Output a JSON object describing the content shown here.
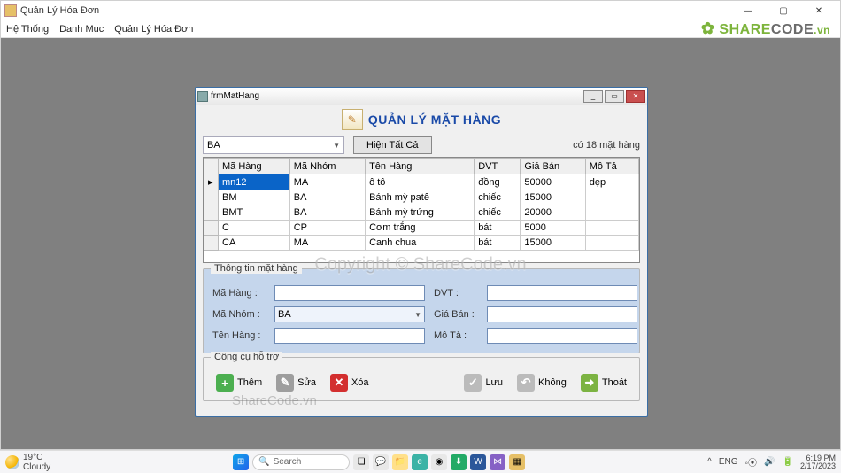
{
  "app": {
    "title": "Quản Lý Hóa Đơn",
    "menus": [
      "Hệ Thống",
      "Danh Mục",
      "Quản Lý Hóa Đơn"
    ]
  },
  "dialog": {
    "win_title": "frmMatHang",
    "title": "QUẢN LÝ MẶT HÀNG",
    "filter_value": "BA",
    "show_all": "Hiện Tất Cả",
    "count_text": "có 18 mặt hàng",
    "columns": [
      "Mã Hàng",
      "Mã Nhóm",
      "Tên Hàng",
      "DVT",
      "Giá Bán",
      "Mô Tả"
    ],
    "rows": [
      {
        "ma": "mn12",
        "nhom": "MA",
        "ten": "ô tô",
        "dvt": "đồng",
        "gia": "50000",
        "mota": "dẹp",
        "sel": true
      },
      {
        "ma": "BM",
        "nhom": "BA",
        "ten": "Bánh mỳ patê",
        "dvt": "chiếc",
        "gia": "15000",
        "mota": ""
      },
      {
        "ma": "BMT",
        "nhom": "BA",
        "ten": "Bánh mỳ trứng",
        "dvt": "chiếc",
        "gia": "20000",
        "mota": ""
      },
      {
        "ma": "C",
        "nhom": "CP",
        "ten": "Cơm trắng",
        "dvt": "bát",
        "gia": "5000",
        "mota": ""
      },
      {
        "ma": "CA",
        "nhom": "MA",
        "ten": "Canh chua",
        "dvt": "bát",
        "gia": "15000",
        "mota": ""
      }
    ],
    "info_group": "Thông tin mặt hàng",
    "labels": {
      "ma": "Mã Hàng :",
      "nhom": "Mã Nhóm :",
      "ten": "Tên Hàng :",
      "dvt": "DVT :",
      "gia": "Giá Bán :",
      "mota": "Mô Tả :"
    },
    "form": {
      "ma": "",
      "nhom": "BA",
      "ten": "",
      "dvt": "",
      "gia": "",
      "mota": ""
    },
    "tool_group": "Công cụ hỗ trợ",
    "buttons": {
      "add": "Thêm",
      "edit": "Sửa",
      "del": "Xóa",
      "save": "Lưu",
      "undo": "Không",
      "exit": "Thoát"
    }
  },
  "watermark": {
    "logo": "SHARECODE",
    "logo_vn": ".vn",
    "small": "ShareCode.vn",
    "center": "Copyright © ShareCode.vn"
  },
  "taskbar": {
    "temp": "19°C",
    "cond": "Cloudy",
    "search": "Search",
    "lang": "ENG",
    "time": "6:19 PM",
    "date": "2/17/2023"
  }
}
